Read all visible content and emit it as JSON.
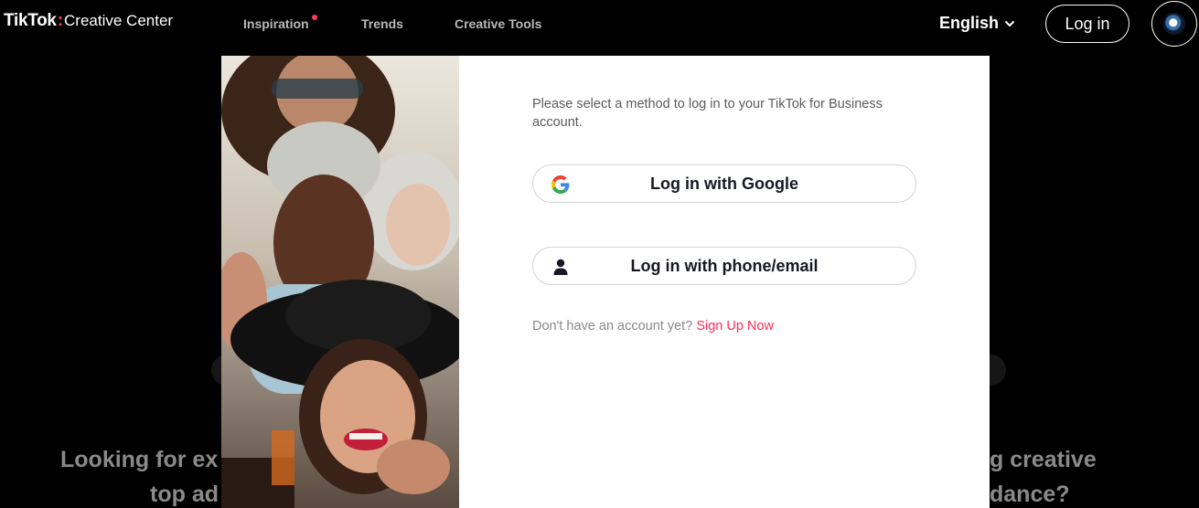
{
  "header": {
    "brand_main": "TikTok",
    "brand_colon": ":",
    "brand_sub": "Creative Center",
    "nav": [
      {
        "label": "Inspiration",
        "has_dot": true
      },
      {
        "label": "Trends"
      },
      {
        "label": "Creative Tools"
      }
    ],
    "language": "English",
    "login_label": "Log in",
    "accent_color": "#fe2c55"
  },
  "hero": {
    "left_line1": "Looking for ex",
    "left_line2": "top ad",
    "right_line1": "g creative",
    "right_line2": "dance?"
  },
  "modal": {
    "intro": "Please select a method to log in to your TikTok for Business account.",
    "google_label": "Log in with Google",
    "phone_label": "Log in with phone/email",
    "signup_prompt": "Don't have an account yet?",
    "signup_link": "Sign Up Now"
  }
}
